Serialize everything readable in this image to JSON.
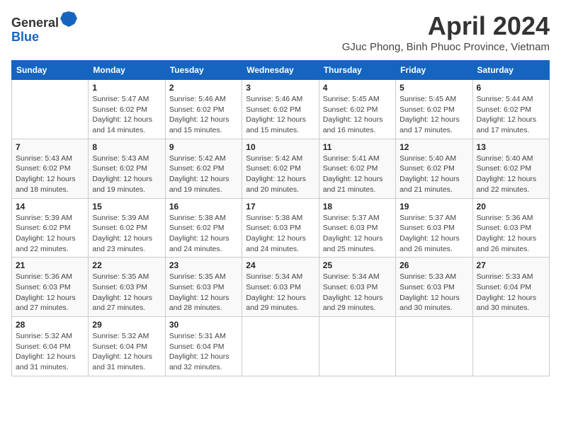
{
  "header": {
    "logo": {
      "line1": "General",
      "line2": "Blue"
    },
    "month_title": "April 2024",
    "subtitle": "GJuc Phong, Binh Phuoc Province, Vietnam"
  },
  "calendar": {
    "days_of_week": [
      "Sunday",
      "Monday",
      "Tuesday",
      "Wednesday",
      "Thursday",
      "Friday",
      "Saturday"
    ],
    "weeks": [
      [
        {
          "num": "",
          "info": ""
        },
        {
          "num": "1",
          "info": "Sunrise: 5:47 AM\nSunset: 6:02 PM\nDaylight: 12 hours and 14 minutes."
        },
        {
          "num": "2",
          "info": "Sunrise: 5:46 AM\nSunset: 6:02 PM\nDaylight: 12 hours and 15 minutes."
        },
        {
          "num": "3",
          "info": "Sunrise: 5:46 AM\nSunset: 6:02 PM\nDaylight: 12 hours and 15 minutes."
        },
        {
          "num": "4",
          "info": "Sunrise: 5:45 AM\nSunset: 6:02 PM\nDaylight: 12 hours and 16 minutes."
        },
        {
          "num": "5",
          "info": "Sunrise: 5:45 AM\nSunset: 6:02 PM\nDaylight: 12 hours and 17 minutes."
        },
        {
          "num": "6",
          "info": "Sunrise: 5:44 AM\nSunset: 6:02 PM\nDaylight: 12 hours and 17 minutes."
        }
      ],
      [
        {
          "num": "7",
          "info": "Sunrise: 5:43 AM\nSunset: 6:02 PM\nDaylight: 12 hours and 18 minutes."
        },
        {
          "num": "8",
          "info": "Sunrise: 5:43 AM\nSunset: 6:02 PM\nDaylight: 12 hours and 19 minutes."
        },
        {
          "num": "9",
          "info": "Sunrise: 5:42 AM\nSunset: 6:02 PM\nDaylight: 12 hours and 19 minutes."
        },
        {
          "num": "10",
          "info": "Sunrise: 5:42 AM\nSunset: 6:02 PM\nDaylight: 12 hours and 20 minutes."
        },
        {
          "num": "11",
          "info": "Sunrise: 5:41 AM\nSunset: 6:02 PM\nDaylight: 12 hours and 21 minutes."
        },
        {
          "num": "12",
          "info": "Sunrise: 5:40 AM\nSunset: 6:02 PM\nDaylight: 12 hours and 21 minutes."
        },
        {
          "num": "13",
          "info": "Sunrise: 5:40 AM\nSunset: 6:02 PM\nDaylight: 12 hours and 22 minutes."
        }
      ],
      [
        {
          "num": "14",
          "info": "Sunrise: 5:39 AM\nSunset: 6:02 PM\nDaylight: 12 hours and 22 minutes."
        },
        {
          "num": "15",
          "info": "Sunrise: 5:39 AM\nSunset: 6:02 PM\nDaylight: 12 hours and 23 minutes."
        },
        {
          "num": "16",
          "info": "Sunrise: 5:38 AM\nSunset: 6:02 PM\nDaylight: 12 hours and 24 minutes."
        },
        {
          "num": "17",
          "info": "Sunrise: 5:38 AM\nSunset: 6:03 PM\nDaylight: 12 hours and 24 minutes."
        },
        {
          "num": "18",
          "info": "Sunrise: 5:37 AM\nSunset: 6:03 PM\nDaylight: 12 hours and 25 minutes."
        },
        {
          "num": "19",
          "info": "Sunrise: 5:37 AM\nSunset: 6:03 PM\nDaylight: 12 hours and 26 minutes."
        },
        {
          "num": "20",
          "info": "Sunrise: 5:36 AM\nSunset: 6:03 PM\nDaylight: 12 hours and 26 minutes."
        }
      ],
      [
        {
          "num": "21",
          "info": "Sunrise: 5:36 AM\nSunset: 6:03 PM\nDaylight: 12 hours and 27 minutes."
        },
        {
          "num": "22",
          "info": "Sunrise: 5:35 AM\nSunset: 6:03 PM\nDaylight: 12 hours and 27 minutes."
        },
        {
          "num": "23",
          "info": "Sunrise: 5:35 AM\nSunset: 6:03 PM\nDaylight: 12 hours and 28 minutes."
        },
        {
          "num": "24",
          "info": "Sunrise: 5:34 AM\nSunset: 6:03 PM\nDaylight: 12 hours and 29 minutes."
        },
        {
          "num": "25",
          "info": "Sunrise: 5:34 AM\nSunset: 6:03 PM\nDaylight: 12 hours and 29 minutes."
        },
        {
          "num": "26",
          "info": "Sunrise: 5:33 AM\nSunset: 6:03 PM\nDaylight: 12 hours and 30 minutes."
        },
        {
          "num": "27",
          "info": "Sunrise: 5:33 AM\nSunset: 6:04 PM\nDaylight: 12 hours and 30 minutes."
        }
      ],
      [
        {
          "num": "28",
          "info": "Sunrise: 5:32 AM\nSunset: 6:04 PM\nDaylight: 12 hours and 31 minutes."
        },
        {
          "num": "29",
          "info": "Sunrise: 5:32 AM\nSunset: 6:04 PM\nDaylight: 12 hours and 31 minutes."
        },
        {
          "num": "30",
          "info": "Sunrise: 5:31 AM\nSunset: 6:04 PM\nDaylight: 12 hours and 32 minutes."
        },
        {
          "num": "",
          "info": ""
        },
        {
          "num": "",
          "info": ""
        },
        {
          "num": "",
          "info": ""
        },
        {
          "num": "",
          "info": ""
        }
      ]
    ]
  }
}
